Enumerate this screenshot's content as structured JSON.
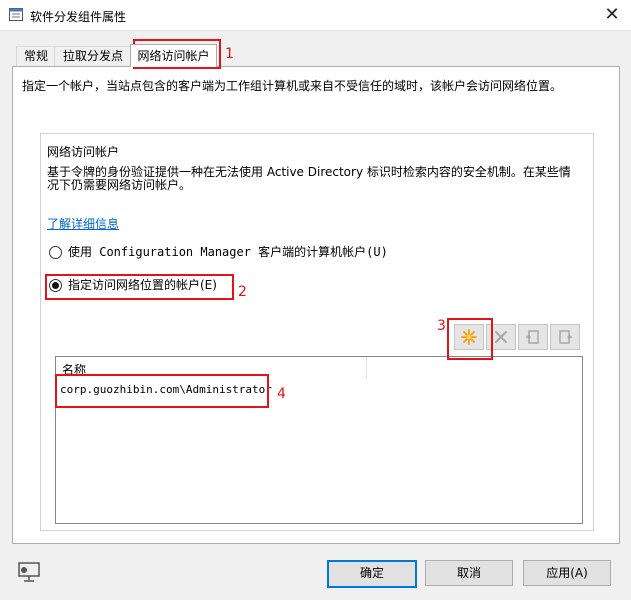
{
  "window": {
    "title": "软件分发组件属性",
    "close_glyph": "✕"
  },
  "tabs": [
    {
      "label": "常规"
    },
    {
      "label": "拉取分发点"
    },
    {
      "label": "网络访问帐户"
    }
  ],
  "panel": {
    "description": "指定一个帐户，当站点包含的客户端为工作组计算机或来自不受信任的域时，该帐户会访问网络位置。"
  },
  "group": {
    "title": "网络访问帐户",
    "description": "基于令牌的身份验证提供一种在无法使用 Active Directory 标识时检索内容的安全机制。在某些情况下仍需要网络访问帐户。",
    "link": "了解详细信息",
    "radio_options": [
      {
        "label": "使用 Configuration Manager 客户端的计算机帐户(U)",
        "checked": false
      },
      {
        "label": "指定访问网络位置的帐户(E)",
        "checked": true
      }
    ]
  },
  "toolbar": {
    "icons": [
      "new-star-icon",
      "delete-x-icon",
      "properties-icon",
      "set-account-icon"
    ]
  },
  "list": {
    "column_header": "名称",
    "rows": [
      "corp.guozhibin.com\\Administrator"
    ]
  },
  "buttons": {
    "ok": "确定",
    "cancel": "取消",
    "apply": "应用(A)"
  },
  "annotations": {
    "n1": "1",
    "n2": "2",
    "n3": "3",
    "n4": "4",
    "color": "#e0151c"
  }
}
